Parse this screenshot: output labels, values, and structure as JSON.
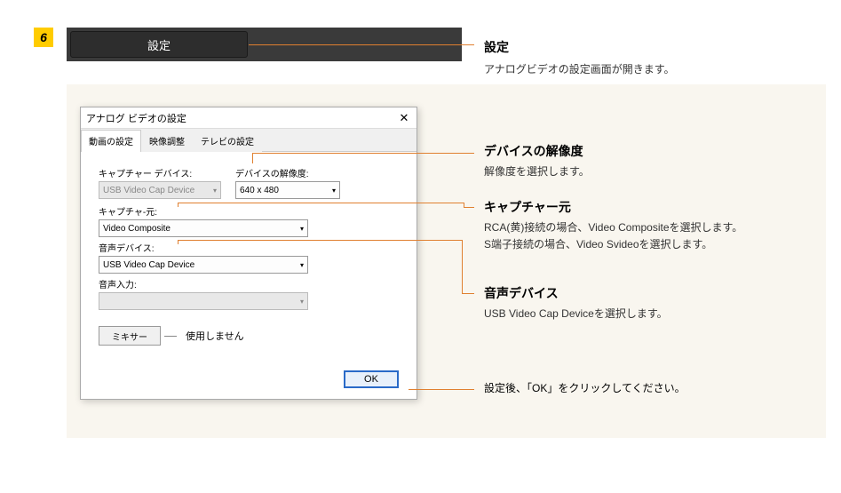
{
  "step": "6",
  "header_button": "設定",
  "ann1": {
    "title": "設定",
    "desc": "アナログビデオの設定画面が開きます。"
  },
  "dialog": {
    "title": "アナログ ビデオの設定",
    "tabs": [
      "動画の設定",
      "映像調整",
      "テレビの設定"
    ],
    "labels": {
      "capture_device": "キャプチャー デバイス:",
      "resolution": "デバイスの解像度:",
      "capture_source": "キャプチャ-元:",
      "audio_device": "音声デバイス:",
      "audio_input": "音声入力:"
    },
    "values": {
      "capture_device": "USB Video Cap Device",
      "resolution": "640 x 480",
      "capture_source": "Video Composite",
      "audio_device": "USB Video Cap Device",
      "audio_input": ""
    },
    "mixer_btn": "ミキサー",
    "mixer_note": "使用しません",
    "ok": "OK"
  },
  "ann2": {
    "title": "デバイスの解像度",
    "desc": "解像度を選択します。"
  },
  "ann3": {
    "title": "キャプチャー元",
    "desc1": "RCA(黄)接続の場合、Video Compositeを選択します。",
    "desc2": "S端子接続の場合、Video Svideoを選択します。"
  },
  "ann4": {
    "title": "音声デバイス",
    "desc": "USB Video Cap Deviceを選択します。"
  },
  "ann5": "設定後、「OK」をクリックしてください。"
}
